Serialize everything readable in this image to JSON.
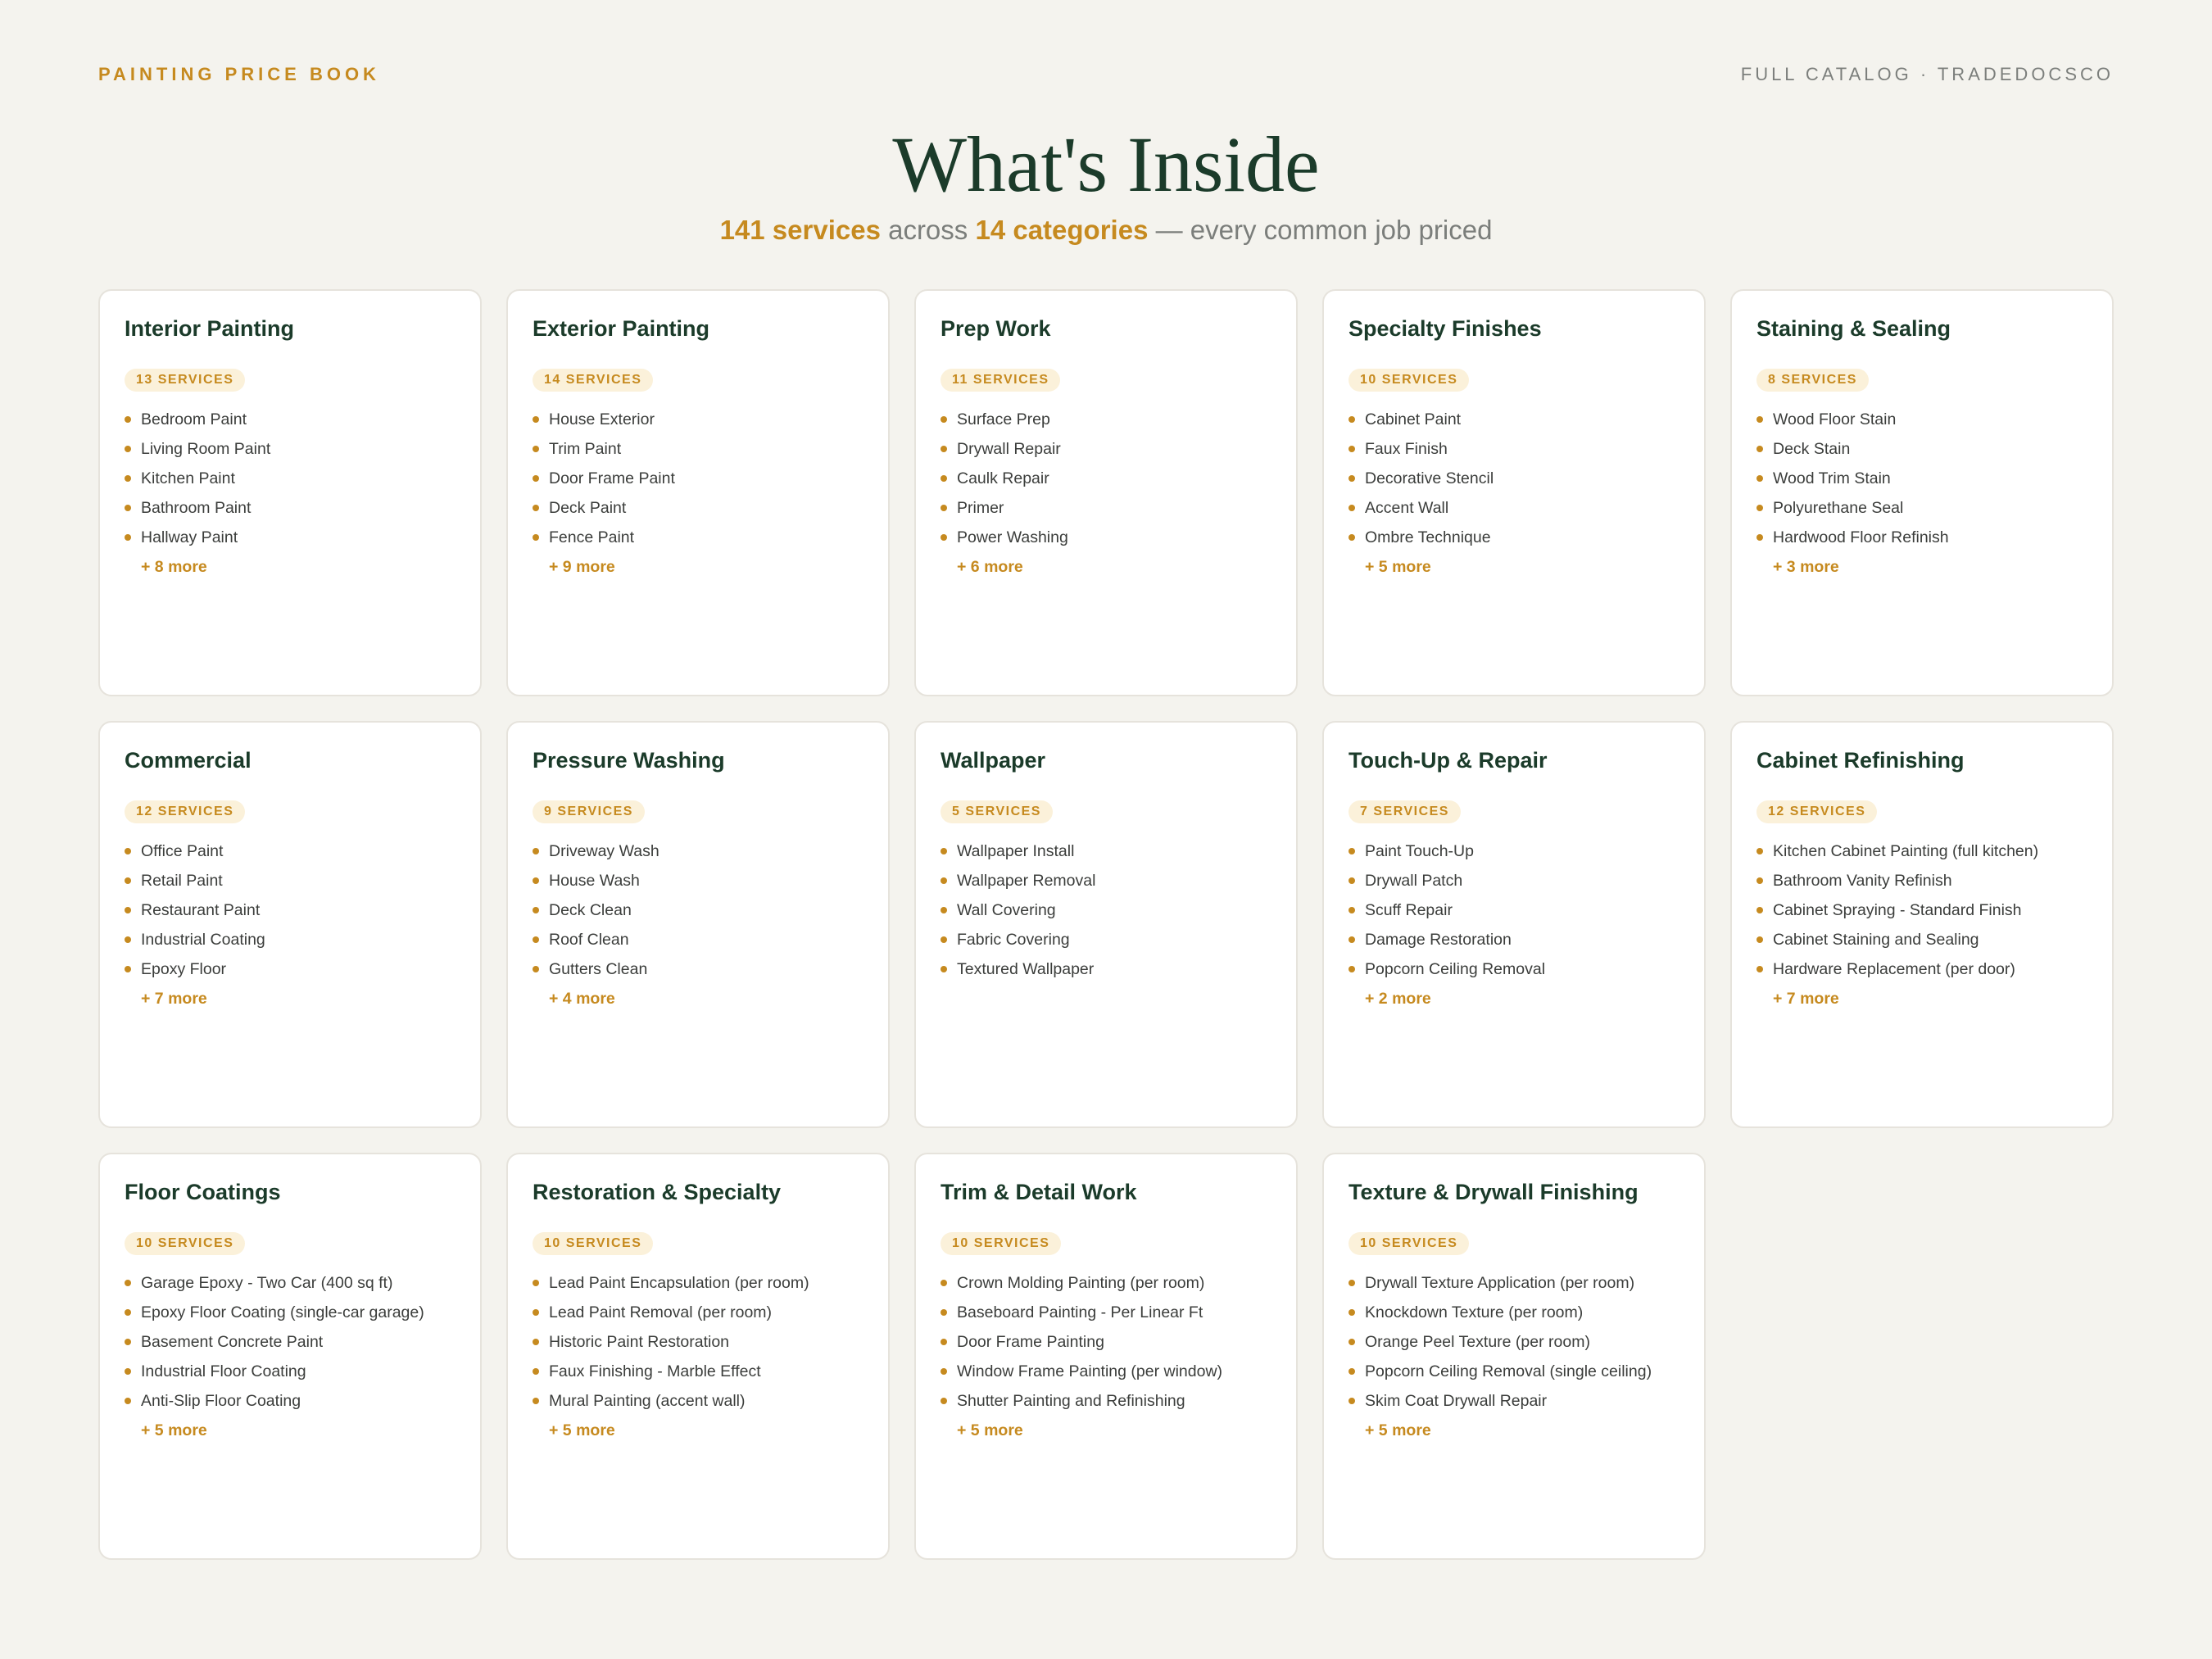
{
  "header": {
    "brand": "PAINTING PRICE BOOK",
    "catalog": "FULL CATALOG · TRADEDOCSCO"
  },
  "hero": {
    "title": "What's Inside",
    "services_count": "141 services",
    "across": " across ",
    "categories_count": "14 categories",
    "tagline": " — every common job priced"
  },
  "colors": {
    "accent": "#c68a1f",
    "title_green": "#1b3b2a",
    "background": "#f4f3ee",
    "badge_bg": "#fbf1da"
  },
  "categories": [
    {
      "title": "Interior Painting",
      "badge": "13 SERVICES",
      "items": [
        "Bedroom Paint",
        "Living Room Paint",
        "Kitchen Paint",
        "Bathroom Paint",
        "Hallway Paint"
      ],
      "more": "+ 8 more"
    },
    {
      "title": "Exterior Painting",
      "badge": "14 SERVICES",
      "items": [
        "House Exterior",
        "Trim Paint",
        "Door Frame Paint",
        "Deck Paint",
        "Fence Paint"
      ],
      "more": "+ 9 more"
    },
    {
      "title": "Prep Work",
      "badge": "11 SERVICES",
      "items": [
        "Surface Prep",
        "Drywall Repair",
        "Caulk Repair",
        "Primer",
        "Power Washing"
      ],
      "more": "+ 6 more"
    },
    {
      "title": "Specialty Finishes",
      "badge": "10 SERVICES",
      "items": [
        "Cabinet Paint",
        "Faux Finish",
        "Decorative Stencil",
        "Accent Wall",
        "Ombre Technique"
      ],
      "more": "+ 5 more"
    },
    {
      "title": "Staining & Sealing",
      "badge": "8 SERVICES",
      "items": [
        "Wood Floor Stain",
        "Deck Stain",
        "Wood Trim Stain",
        "Polyurethane Seal",
        "Hardwood Floor Refinish"
      ],
      "more": "+ 3 more"
    },
    {
      "title": "Commercial",
      "badge": "12 SERVICES",
      "items": [
        "Office Paint",
        "Retail Paint",
        "Restaurant Paint",
        "Industrial Coating",
        "Epoxy Floor"
      ],
      "more": "+ 7 more"
    },
    {
      "title": "Pressure Washing",
      "badge": "9 SERVICES",
      "items": [
        "Driveway Wash",
        "House Wash",
        "Deck Clean",
        "Roof Clean",
        "Gutters Clean"
      ],
      "more": "+ 4 more"
    },
    {
      "title": "Wallpaper",
      "badge": "5 SERVICES",
      "items": [
        "Wallpaper Install",
        "Wallpaper Removal",
        "Wall Covering",
        "Fabric Covering",
        "Textured Wallpaper"
      ],
      "more": ""
    },
    {
      "title": "Touch-Up & Repair",
      "badge": "7 SERVICES",
      "items": [
        "Paint Touch-Up",
        "Drywall Patch",
        "Scuff Repair",
        "Damage Restoration",
        "Popcorn Ceiling Removal"
      ],
      "more": "+ 2 more"
    },
    {
      "title": "Cabinet Refinishing",
      "badge": "12 SERVICES",
      "items": [
        "Kitchen Cabinet Painting (full kitchen)",
        "Bathroom Vanity Refinish",
        "Cabinet Spraying - Standard Finish",
        "Cabinet Staining and Sealing",
        "Hardware Replacement (per door)"
      ],
      "more": "+ 7 more"
    },
    {
      "title": "Floor Coatings",
      "badge": "10 SERVICES",
      "items": [
        "Garage Epoxy - Two Car (400 sq ft)",
        "Epoxy Floor Coating (single-car garage)",
        "Basement Concrete Paint",
        "Industrial Floor Coating",
        "Anti-Slip Floor Coating"
      ],
      "more": "+ 5 more"
    },
    {
      "title": "Restoration & Specialty",
      "badge": "10 SERVICES",
      "items": [
        "Lead Paint Encapsulation (per room)",
        "Lead Paint Removal (per room)",
        "Historic Paint Restoration",
        "Faux Finishing - Marble Effect",
        "Mural Painting (accent wall)"
      ],
      "more": "+ 5 more"
    },
    {
      "title": "Trim & Detail Work",
      "badge": "10 SERVICES",
      "items": [
        "Crown Molding Painting (per room)",
        "Baseboard Painting - Per Linear Ft",
        "Door Frame Painting",
        "Window Frame Painting (per window)",
        "Shutter Painting and Refinishing"
      ],
      "more": "+ 5 more"
    },
    {
      "title": "Texture & Drywall Finishing",
      "badge": "10 SERVICES",
      "items": [
        "Drywall Texture Application (per room)",
        "Knockdown Texture (per room)",
        "Orange Peel Texture (per room)",
        "Popcorn Ceiling Removal (single ceiling)",
        "Skim Coat Drywall Repair"
      ],
      "more": "+ 5 more"
    }
  ]
}
